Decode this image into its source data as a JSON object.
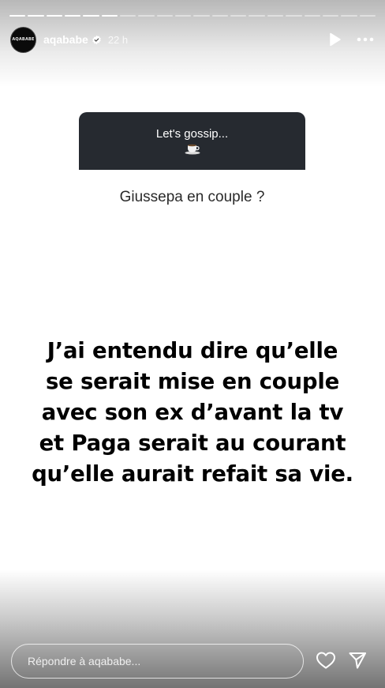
{
  "story": {
    "segments": 20,
    "completed_segments": 6,
    "current_segment_progress": 1.0
  },
  "header": {
    "avatar_text": "AQABABE",
    "username": "aqababe",
    "verified": true,
    "time": "22 h",
    "icons": [
      "play-icon",
      "more-icon"
    ]
  },
  "sticker": {
    "prompt": "Let's gossip...",
    "emoji": "coffee-cup",
    "answer": "Giussepa en couple ?"
  },
  "main_text": {
    "lines": [
      "J’ai entendu dire qu’elle",
      "se serait mise en couple",
      "avec son ex d’avant la tv",
      "et Paga serait au courant",
      "qu’elle aurait refait sa vie."
    ]
  },
  "footer": {
    "reply_placeholder": "Répondre à aqababe...",
    "icons": [
      "heart-icon",
      "send-icon"
    ]
  },
  "colors": {
    "background": "#ffffff",
    "sticker_dark": "#262a30",
    "text": "#000000"
  }
}
